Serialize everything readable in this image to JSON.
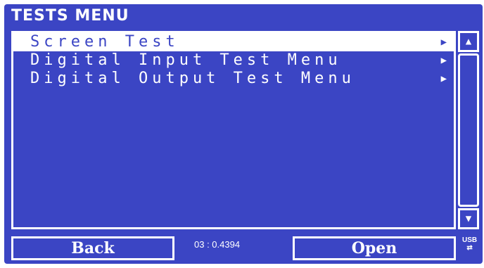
{
  "header": {
    "title": "TESTS MENU"
  },
  "menu": {
    "items": [
      {
        "label": "Screen Test",
        "selected": true
      },
      {
        "label": "Digital Input Test Menu",
        "selected": false
      },
      {
        "label": "Digital Output Test Menu",
        "selected": false
      }
    ],
    "submenu_arrow": "▶"
  },
  "scrollbar": {
    "up_icon": "▲",
    "down_icon": "▼"
  },
  "footer": {
    "back_label": "Back",
    "open_label": "Open",
    "status_text": "03 : 0.4394",
    "usb_label": "USB",
    "usb_icon": "⇄"
  },
  "colors": {
    "background": "#3b45c4",
    "foreground": "#ffffff"
  }
}
